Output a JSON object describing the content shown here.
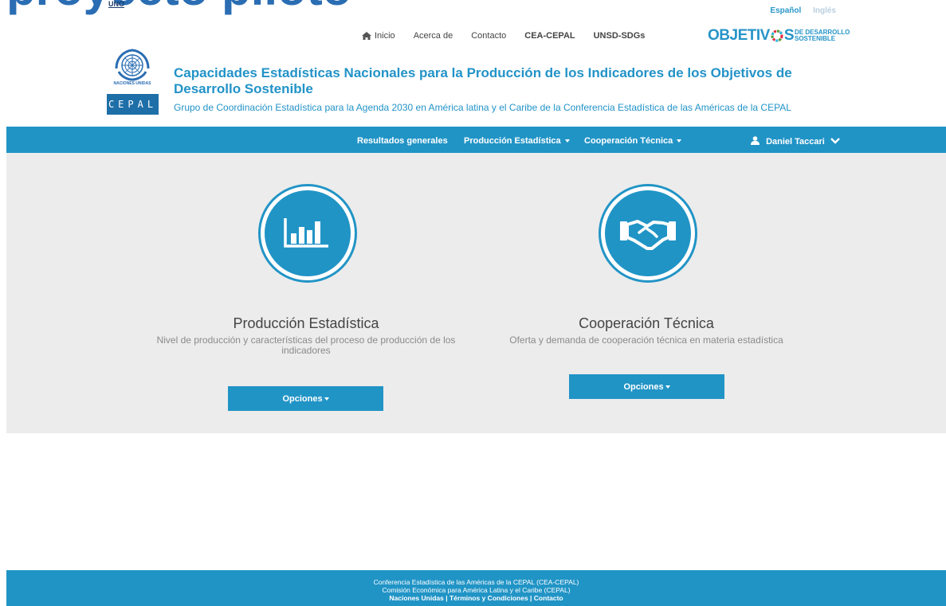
{
  "banner": {
    "clipped_text": "proyecto piloto",
    "clipped_small": "UNO"
  },
  "language": {
    "spanish": "Español",
    "english": "Inglés"
  },
  "topnav": {
    "home": "Inicio",
    "about": "Acerca de",
    "contact": "Contacto",
    "cea_cepal": "CEA-CEPAL",
    "unsd_sdgs": "UNSD-SDGs"
  },
  "ods_logo": {
    "big_left": "OBJETIV",
    "big_right": "S",
    "small_top": "DE DESARROLLO",
    "small_bottom": "SOSTENIBLE"
  },
  "header": {
    "un_label": "NACIONES UNIDAS",
    "cepal_label": "CEPAL",
    "title": "Capacidades Estadísticas Nacionales para la Producción de los Indicadores de los Objetivos de Desarrollo Sostenible",
    "subtitle": "Grupo de Coordinación Estadística para la Agenda 2030 en América latina y el Caribe de la Conferencia Estadística de las Américas de la CEPAL"
  },
  "mainnav": {
    "results": "Resultados generales",
    "production": "Producción Estadística",
    "cooperation": "Cooperación Técnica",
    "user": "Daniel Taccari"
  },
  "cards": {
    "production": {
      "title": "Producción Estadística",
      "description": "Nivel de producción y características del proceso de producción de los indicadores",
      "button": "Opciones"
    },
    "cooperation": {
      "title": "Cooperación Técnica",
      "description": "Oferta y demanda de cooperación técnica en materia estadística",
      "button": "Opciones"
    }
  },
  "footer": {
    "line1": "Conferencia Estadística de las Américas de la CEPAL (CEA-CEPAL)",
    "line2": "Comisión Económica para América Latina y el Caribe (CEPAL)",
    "link_un": "Naciones Unidas",
    "link_terms": "Términos y Condiciones",
    "link_contact": "Contacto",
    "separator": " | "
  },
  "colors": {
    "primary": "#2194c6",
    "panel_bg": "#ececec",
    "title_blue": "#2293c8"
  }
}
